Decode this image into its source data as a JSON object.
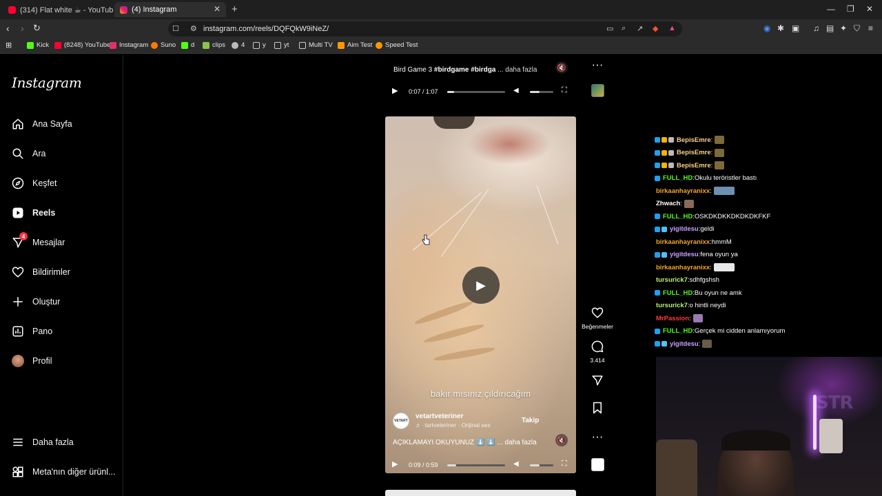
{
  "browser": {
    "tabs": [
      {
        "title": "(314) Flat white ☕ - YouTube",
        "active": false
      },
      {
        "title": "(4) Instagram",
        "active": true
      }
    ],
    "url": "instagram.com/reels/DQFQkW9iNeZ/",
    "bookmarks": [
      {
        "label": "Kick",
        "color": "#53fc18"
      },
      {
        "label": "(8248) YouTube",
        "color": "#ff0033"
      },
      {
        "label": "Instagram",
        "color": "#e1306c"
      },
      {
        "label": "Suno",
        "color": "#ff7a00"
      },
      {
        "label": "d",
        "color": "#53fc18"
      },
      {
        "label": "clips",
        "color": "#8bc34a"
      },
      {
        "label": "4",
        "color": "#bbbbbb"
      },
      {
        "label": "y",
        "color": "#bbbbbb"
      },
      {
        "label": "yt",
        "color": "#bbbbbb"
      },
      {
        "label": "Multi TV",
        "color": "#bbbbbb"
      },
      {
        "label": "Aim Test",
        "color": "#ff9800"
      },
      {
        "label": "Speed Test",
        "color": "#ff9800"
      }
    ]
  },
  "instagram": {
    "logo": "Instagram",
    "nav": [
      {
        "label": "Ana Sayfa",
        "icon": "home-icon"
      },
      {
        "label": "Ara",
        "icon": "search-icon"
      },
      {
        "label": "Keşfet",
        "icon": "compass-icon"
      },
      {
        "label": "Reels",
        "icon": "reels-icon",
        "active": true
      },
      {
        "label": "Mesajlar",
        "icon": "messenger-icon",
        "badge": "4"
      },
      {
        "label": "Bildirimler",
        "icon": "heart-icon"
      },
      {
        "label": "Oluştur",
        "icon": "plus-icon"
      },
      {
        "label": "Pano",
        "icon": "dashboard-icon"
      },
      {
        "label": "Profil",
        "icon": "avatar"
      }
    ],
    "more_label": "Daha fazla",
    "meta_label": "Meta'nın diğer ürünl..."
  },
  "reel_prev": {
    "caption_text": "Bird Game 3 ",
    "caption_tags": "#birdgame #birdga",
    "caption_more": " ... daha fazla",
    "time": "0:07 / 1:07",
    "progress": 0.12,
    "volume": 0.4
  },
  "reel_current": {
    "subtitle": "bakır mısınız çıldırıcağım",
    "author": "vetartveteriner",
    "audio": "♬ ·tartveteriner · Orijinal ses",
    "follow_label": "Takip",
    "caption": "AÇIKLAMAYI OKUYUNUZ ⬇️ ⬇️ ... daha fazla",
    "time": "0:09 / 0:59",
    "progress": 0.15,
    "volume": 0.4,
    "likes_label": "Beğenmeler",
    "comments_count": "3.414"
  },
  "chat": [
    {
      "user": "BepisEmre",
      "color": "#ffd08a",
      "badges": [
        "#1da1f2",
        "#f5b400",
        "#bbbbbb"
      ],
      "text": "",
      "emote": "#7c6a3a"
    },
    {
      "user": "BepisEmre",
      "color": "#ffd08a",
      "badges": [
        "#1da1f2",
        "#f5b400",
        "#bbbbbb"
      ],
      "text": "",
      "emote": "#7c6a3a"
    },
    {
      "user": "BepisEmre",
      "color": "#ffd08a",
      "badges": [
        "#1da1f2",
        "#f5b400",
        "#bbbbbb"
      ],
      "text": "",
      "emote": "#7c6a3a"
    },
    {
      "user": "FULL_HD",
      "color": "#53fc18",
      "badges": [
        "#1da1f2"
      ],
      "text": "Okulu teröristler bastı",
      "emote": ""
    },
    {
      "user": "birkaanhayranixx",
      "color": "#f5a623",
      "badges": [],
      "text": "",
      "emote": "#6d8fb0"
    },
    {
      "user": "Zhwach",
      "color": "#ffffff",
      "badges": [],
      "text": "",
      "emote": "#8a6a5a"
    },
    {
      "user": "FULL_HD",
      "color": "#53fc18",
      "badges": [
        "#1da1f2"
      ],
      "text": "OSKDKDKKDKDKDKFKF",
      "emote": ""
    },
    {
      "user": "yigitdesu",
      "color": "#c9a0ff",
      "badges": [
        "#1da1f2",
        "#4fc3f7"
      ],
      "text": "geldi",
      "emote": ""
    },
    {
      "user": "birkaanhayranixx",
      "color": "#f5a623",
      "badges": [],
      "text": "hmmM",
      "emote": ""
    },
    {
      "user": "yigitdesu",
      "color": "#c9a0ff",
      "badges": [
        "#1da1f2",
        "#4fc3f7"
      ],
      "text": "fena oyun ya",
      "emote": ""
    },
    {
      "user": "birkaanhayranixx",
      "color": "#f5a623",
      "badges": [],
      "text": "",
      "emote": "#e8e8e8"
    },
    {
      "user": "tursurick7",
      "color": "#b8f070",
      "badges": [],
      "text": "sdhfgshsh",
      "emote": ""
    },
    {
      "user": "FULL_HD",
      "color": "#53fc18",
      "badges": [
        "#1da1f2"
      ],
      "text": "Bu oyun ne amk",
      "emote": ""
    },
    {
      "user": "tursurick7",
      "color": "#b8f070",
      "badges": [],
      "text": "o hintli neydi",
      "emote": ""
    },
    {
      "user": "MrPassion",
      "color": "#ff3b3b",
      "badges": [],
      "text": "",
      "emote": "#9a7ab0"
    },
    {
      "user": "FULL_HD",
      "color": "#53fc18",
      "badges": [
        "#1da1f2"
      ],
      "text": "Gerçek mi cidden anlamıyorum",
      "emote": ""
    },
    {
      "user": "yigitdesu",
      "color": "#c9a0ff",
      "badges": [
        "#1da1f2",
        "#4fc3f7"
      ],
      "text": "",
      "emote": "#6a5a4a"
    }
  ],
  "webcam": {
    "sign_text": "STR"
  },
  "colors": {
    "accent": "#ff3040",
    "bg": "#000000",
    "sidebar_border": "#262626"
  }
}
